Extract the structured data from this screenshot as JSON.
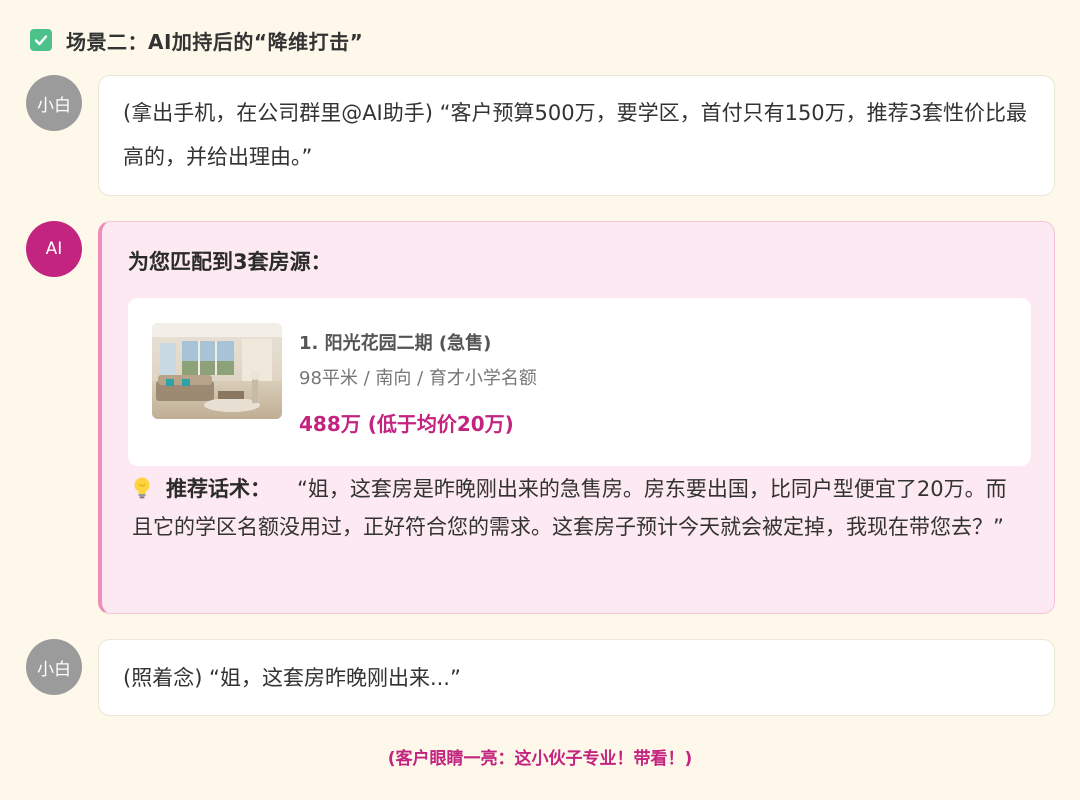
{
  "scene": {
    "title": "场景二：AI加持后的“降维打击”",
    "check_icon": "check-box-icon",
    "check_color": "#4cc28a"
  },
  "messages": [
    {
      "sender": "小白",
      "avatar_color": "#9b9b9b",
      "text": "(拿出手机，在公司群里@AI助手) “客户预算500万，要学区，首付只有150万，推荐3套性价比最高的，并给出理由。”"
    },
    {
      "sender": "AI",
      "avatar_color": "#c2247f",
      "heading": "为您匹配到3套房源：",
      "house": {
        "name": "1. 阳光花园二期 (急售)",
        "meta": "98平米 / 南向 / 育才小学名额",
        "price": "488万 (低于均价20万)",
        "photo_icon": "living-room-photo"
      },
      "pitch_icon": "light-bulb-icon",
      "pitch_label": "推荐话术：",
      "pitch_text": "“姐，这套房是昨晚刚出来的急售房。房东要出国，比同户型便宜了20万。而且它的学区名额没用过，正好符合您的需求。这套房子预计今天就会被定掉，我现在带您去？”"
    },
    {
      "sender": "小白",
      "avatar_color": "#9b9b9b",
      "text": "(照着念) “姐，这套房昨晚刚出来...”"
    }
  ],
  "footer_note": "(客户眼睛一亮：这小伙子专业！带看！)",
  "colors": {
    "background": "#fdf8ea",
    "accent": "#c2247f",
    "ai_bubble_bg": "#fde9f1",
    "ai_bubble_border": "#ef8cb8"
  }
}
